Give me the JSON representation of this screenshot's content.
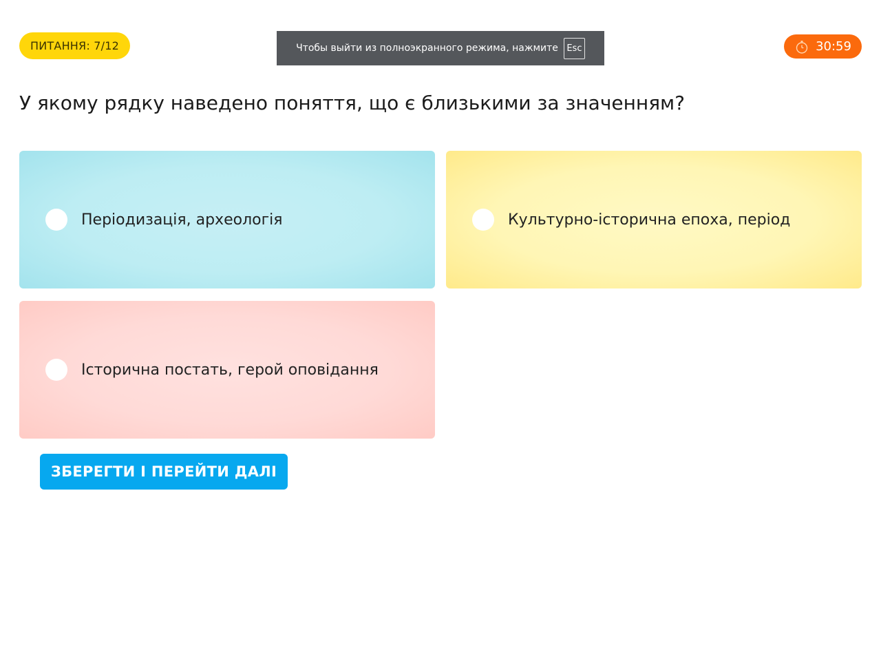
{
  "header": {
    "question_counter": "ПИТАННЯ: 7/12",
    "fullscreen_notice": {
      "text": "Чтобы выйти из полноэкранного режима, нажмите",
      "key": "Esc"
    },
    "timer": {
      "icon": "stopwatch-icon",
      "value": "30:59"
    }
  },
  "question": {
    "text": "У якому рядку наведено поняття, що є близькими за значенням?"
  },
  "options": [
    {
      "label": "Періодизація, археологія",
      "selected": false,
      "color": "#bdedf3"
    },
    {
      "label": "Культурно-історична епоха, період",
      "selected": false,
      "color": "#fff6b5"
    },
    {
      "label": "Історична постать, герой оповідання",
      "selected": false,
      "color": "#ffdad7"
    }
  ],
  "actions": {
    "save_label": "ЗБЕРЕГТИ І ПЕРЕЙТИ ДАЛІ"
  },
  "colors": {
    "counter_bg": "#ffd60a",
    "timer_bg": "#fb6a0d",
    "button_bg": "#07a8ef",
    "notice_bg": "#54575b"
  }
}
